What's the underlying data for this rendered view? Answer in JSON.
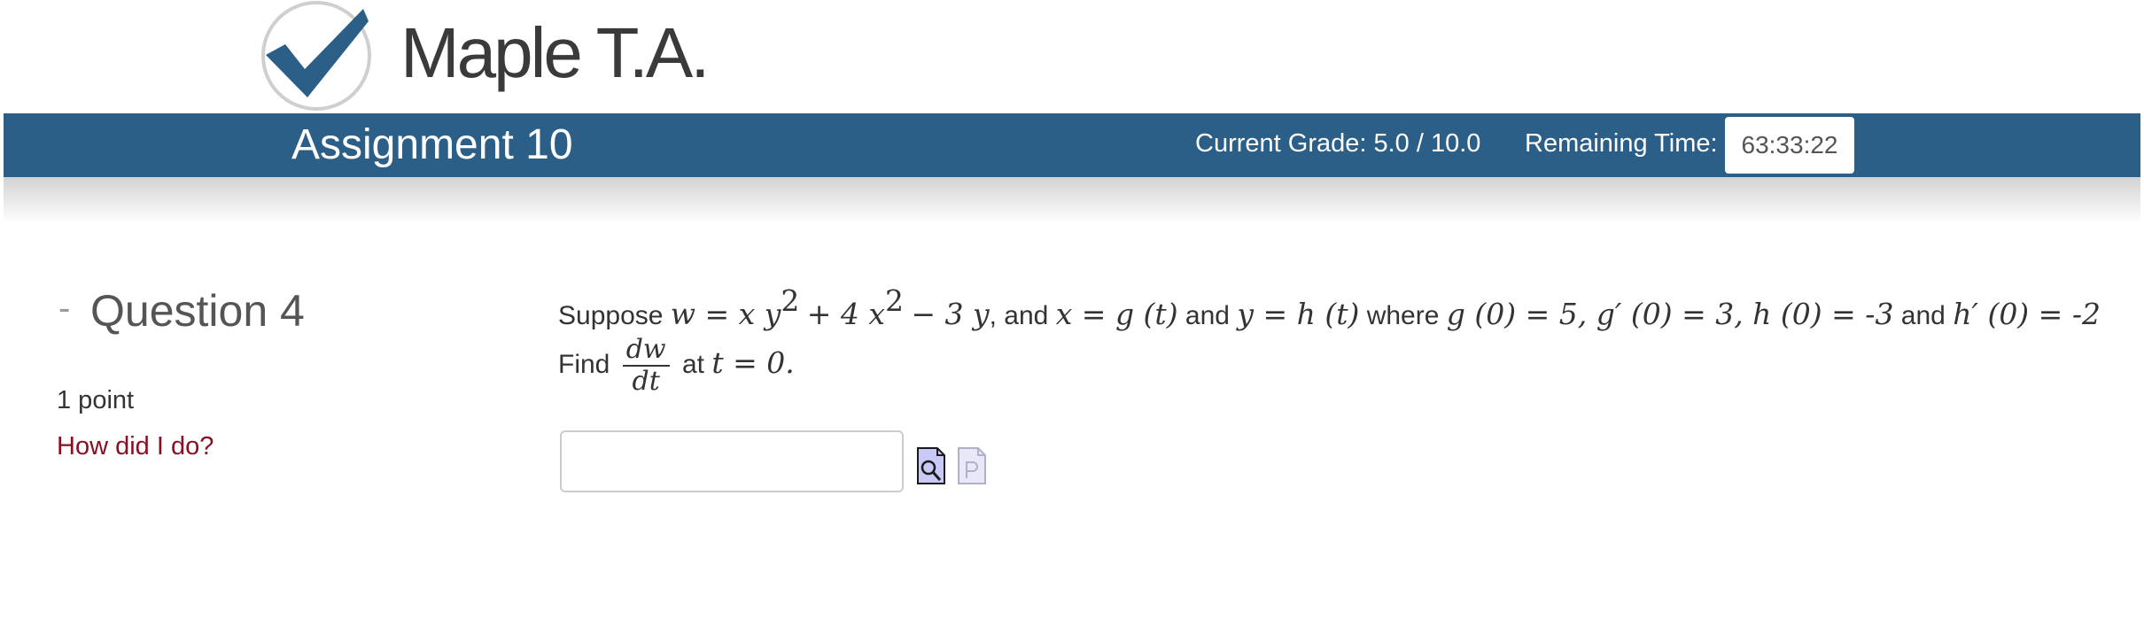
{
  "logo": {
    "text": "Maple T.A.",
    "icon": "checkmark-logo-icon"
  },
  "banner": {
    "assignment_title": "Assignment 10",
    "grade": "Current Grade: 5.0 / 10.0",
    "time_label": "Remaining Time:",
    "time_value": "63:33:22",
    "color": "#2b5f87"
  },
  "question": {
    "toggle": "-",
    "title": "Question 4",
    "points": "1 point",
    "how_link": "How did I do?",
    "line1": {
      "t1": "Suppose",
      "m1": "w = x y",
      "e1": "2",
      "m2": "+ 4 x",
      "e2": "2",
      "m3": "− 3 y",
      "t2": ", and",
      "m4": "x = g (t)",
      "t3": "and",
      "m5": "y = h (t)",
      "t4": "where",
      "m6": "g (0) = 5, g′ (0) = 3, h (0) = -3",
      "t5": "and",
      "m7": "h′ (0) = -2"
    },
    "line2": {
      "t1": "Find",
      "num": "dw",
      "den": "dt",
      "t2": "at",
      "m1": "t = 0."
    },
    "answer": {
      "value": "",
      "placeholder": ""
    },
    "icons": {
      "preview": "preview-icon",
      "file": "file-p-icon"
    },
    "link_color": "#8a0f24"
  }
}
